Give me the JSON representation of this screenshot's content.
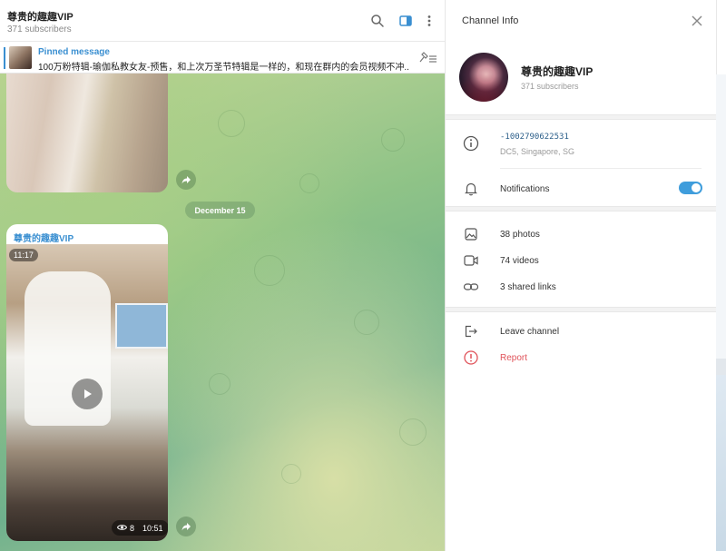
{
  "chat": {
    "title": "尊贵的趣趣VIP",
    "subscribers": "371 subscribers",
    "icons": [
      "search-icon",
      "sidebar-toggle-icon",
      "more-vertical-icon"
    ],
    "pinned": {
      "label": "Pinned message",
      "text": "100万粉特辑-瑜伽私教女友-预售，和上次万圣节特辑是一样的，和现在群内的会员视频不冲..."
    },
    "date_separator": "December 15",
    "message": {
      "author": "尊贵的趣趣VIP",
      "video_duration": "11:17",
      "views": "8",
      "time": "10:51"
    }
  },
  "info_panel": {
    "title": "Channel Info",
    "channel_name": "尊贵的趣趣VIP",
    "subscribers": "371 subscribers",
    "channel_id": "-1002790622531",
    "dc_location": "DC5, Singapore, SG",
    "notifications_label": "Notifications",
    "notifications_enabled": true,
    "media": [
      {
        "icon": "image-icon",
        "label": "38 photos"
      },
      {
        "icon": "video-icon",
        "label": "74 videos"
      },
      {
        "icon": "link-icon",
        "label": "3 shared links"
      }
    ],
    "actions": [
      {
        "icon": "leave-icon",
        "label": "Leave channel"
      },
      {
        "icon": "report-icon",
        "label": "Report"
      }
    ]
  },
  "colors": {
    "accent": "#3a8fd1",
    "toggle": "#3f9ddc",
    "report": "#e0535a"
  }
}
